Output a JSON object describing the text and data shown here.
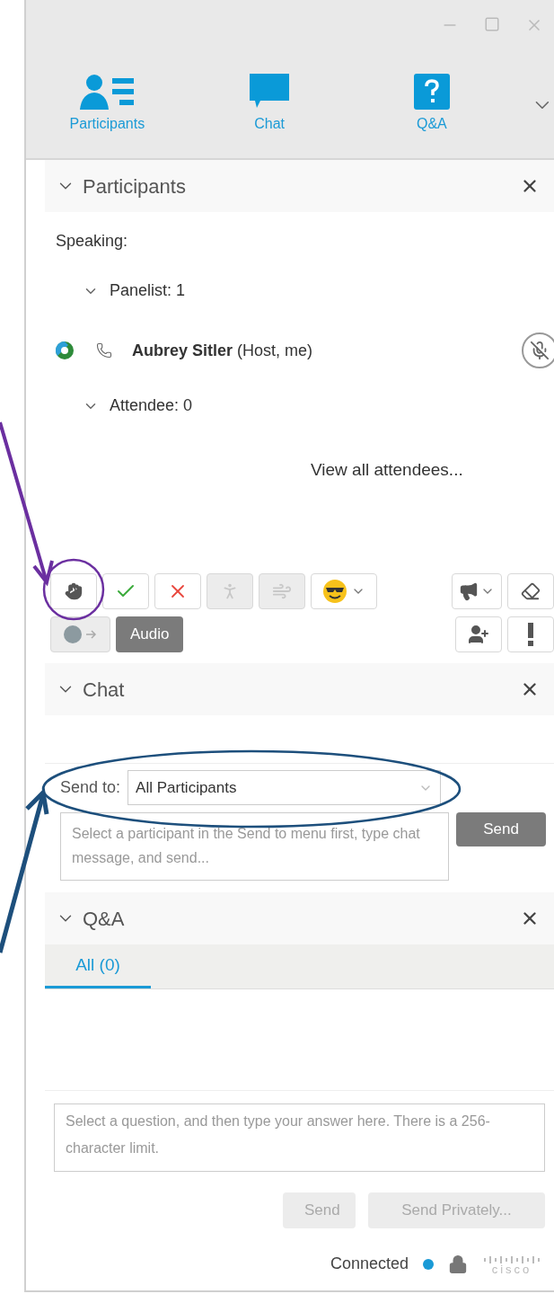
{
  "tabs": [
    {
      "label": "Participants",
      "kind": "participants"
    },
    {
      "label": "Chat",
      "kind": "chat"
    },
    {
      "label": "Q&A",
      "kind": "qa"
    }
  ],
  "participants_panel": {
    "title": "Participants",
    "speaking_label": "Speaking:",
    "groups": [
      {
        "label": "Panelist: 1",
        "expanded": true,
        "members": [
          {
            "name": "Aubrey Sitler",
            "role": "(Host, me)",
            "muted": true
          }
        ]
      },
      {
        "label": "Attendee: 0",
        "expanded": true
      }
    ],
    "view_all_link": "View all attendees..."
  },
  "toolbar": [
    {
      "left": [
        {
          "kind": "hand",
          "disabled": false
        },
        {
          "kind": "check",
          "disabled": false
        },
        {
          "kind": "cross",
          "disabled": false
        },
        {
          "kind": "walk",
          "disabled": true
        },
        {
          "kind": "run",
          "disabled": true
        },
        {
          "kind": "emoji",
          "disabled": false
        }
      ],
      "right": [
        {
          "kind": "megaphone",
          "disabled": false
        },
        {
          "kind": "eraser",
          "disabled": false
        }
      ]
    },
    {
      "left": [
        {
          "kind": "globe",
          "disabled": true
        },
        {
          "kind": "text",
          "label": "Audio",
          "disabled": false
        }
      ],
      "right": [
        {
          "kind": "add-user",
          "disabled": false
        },
        {
          "kind": "alert",
          "disabled": false
        }
      ]
    }
  ],
  "chat": {
    "title": "Chat",
    "send_to_label": "Send to:",
    "recipient": "All Participants",
    "message_placeholder": "Select a participant in the Send to menu first, type chat message, and send...",
    "send_button": "Send"
  },
  "qa": {
    "title": "Q&A",
    "tabs": [
      {
        "label": "All (0)",
        "selected": true
      }
    ],
    "answer_placeholder": "Select a question, and then type your answer here. There is a 256-character limit.",
    "buttons": [
      {
        "label": "Send",
        "disabled": true
      },
      {
        "label": "Send Privately...",
        "disabled": true
      }
    ]
  },
  "status": {
    "label": "Connected",
    "connected": true,
    "logo": "cisco"
  },
  "annotations": [
    {
      "kind": "circle",
      "color": "#6b2fa0"
    },
    {
      "kind": "ellipse",
      "color": "#1d4f7c"
    }
  ]
}
